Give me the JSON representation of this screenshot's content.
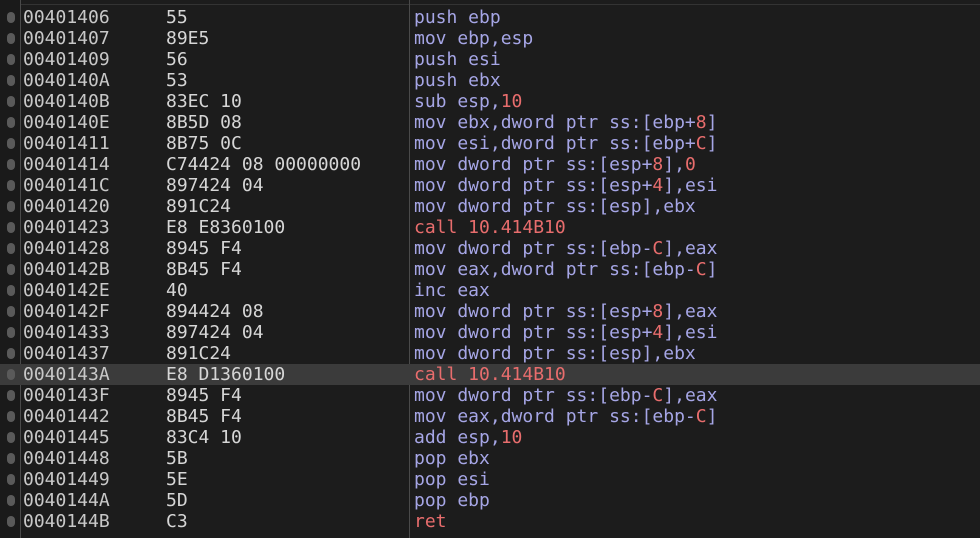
{
  "rows": [
    {
      "addr": "00401406",
      "bytes": "55",
      "instr": [
        [
          "push ebp",
          "p"
        ]
      ]
    },
    {
      "addr": "00401407",
      "bytes": "89E5",
      "instr": [
        [
          "mov ebp,esp",
          "p"
        ]
      ]
    },
    {
      "addr": "00401409",
      "bytes": "56",
      "instr": [
        [
          "push esi",
          "p"
        ]
      ]
    },
    {
      "addr": "0040140A",
      "bytes": "53",
      "instr": [
        [
          "push ebx",
          "p"
        ]
      ]
    },
    {
      "addr": "0040140B",
      "bytes": "83EC 10",
      "instr": [
        [
          "sub esp,",
          "p"
        ],
        [
          "10",
          "n"
        ]
      ]
    },
    {
      "addr": "0040140E",
      "bytes": "8B5D 08",
      "instr": [
        [
          "mov ebx,dword ptr ss:[ebp+",
          "p"
        ],
        [
          "8",
          "n"
        ],
        [
          "]",
          "p"
        ]
      ]
    },
    {
      "addr": "00401411",
      "bytes": "8B75 0C",
      "instr": [
        [
          "mov esi,dword ptr ss:[ebp+",
          "p"
        ],
        [
          "C",
          "n"
        ],
        [
          "]",
          "p"
        ]
      ]
    },
    {
      "addr": "00401414",
      "bytes": "C74424 08 00000000",
      "instr": [
        [
          "mov dword ptr ss:[esp+",
          "p"
        ],
        [
          "8",
          "n"
        ],
        [
          "],",
          "p"
        ],
        [
          "0",
          "n"
        ]
      ]
    },
    {
      "addr": "0040141C",
      "bytes": "897424 04",
      "instr": [
        [
          "mov dword ptr ss:[esp+",
          "p"
        ],
        [
          "4",
          "n"
        ],
        [
          "],esi",
          "p"
        ]
      ]
    },
    {
      "addr": "00401420",
      "bytes": "891C24",
      "instr": [
        [
          "mov dword ptr ss:[esp],ebx",
          "p"
        ]
      ]
    },
    {
      "addr": "00401423",
      "bytes": "E8 E8360100",
      "instr": [
        [
          "call 10.414B10",
          "c"
        ]
      ]
    },
    {
      "addr": "00401428",
      "bytes": "8945 F4",
      "instr": [
        [
          "mov dword ptr ss:[ebp-",
          "p"
        ],
        [
          "C",
          "n"
        ],
        [
          "],eax",
          "p"
        ]
      ]
    },
    {
      "addr": "0040142B",
      "bytes": "8B45 F4",
      "instr": [
        [
          "mov eax,dword ptr ss:[ebp-",
          "p"
        ],
        [
          "C",
          "n"
        ],
        [
          "]",
          "p"
        ]
      ]
    },
    {
      "addr": "0040142E",
      "bytes": "40",
      "instr": [
        [
          "inc eax",
          "p"
        ]
      ]
    },
    {
      "addr": "0040142F",
      "bytes": "894424 08",
      "instr": [
        [
          "mov dword ptr ss:[esp+",
          "p"
        ],
        [
          "8",
          "n"
        ],
        [
          "],eax",
          "p"
        ]
      ]
    },
    {
      "addr": "00401433",
      "bytes": "897424 04",
      "instr": [
        [
          "mov dword ptr ss:[esp+",
          "p"
        ],
        [
          "4",
          "n"
        ],
        [
          "],esi",
          "p"
        ]
      ]
    },
    {
      "addr": "00401437",
      "bytes": "891C24",
      "instr": [
        [
          "mov dword ptr ss:[esp],ebx",
          "p"
        ]
      ]
    },
    {
      "addr": "0040143A",
      "bytes": "E8 D1360100",
      "instr": [
        [
          "call 10.414B10",
          "c"
        ]
      ],
      "selected": true
    },
    {
      "addr": "0040143F",
      "bytes": "8945 F4",
      "instr": [
        [
          "mov dword ptr ss:[ebp-",
          "p"
        ],
        [
          "C",
          "n"
        ],
        [
          "],eax",
          "p"
        ]
      ]
    },
    {
      "addr": "00401442",
      "bytes": "8B45 F4",
      "instr": [
        [
          "mov eax,dword ptr ss:[ebp-",
          "p"
        ],
        [
          "C",
          "n"
        ],
        [
          "]",
          "p"
        ]
      ]
    },
    {
      "addr": "00401445",
      "bytes": "83C4 10",
      "instr": [
        [
          "add esp,",
          "p"
        ],
        [
          "10",
          "n"
        ]
      ]
    },
    {
      "addr": "00401448",
      "bytes": "5B",
      "instr": [
        [
          "pop ebx",
          "p"
        ]
      ]
    },
    {
      "addr": "00401449",
      "bytes": "5E",
      "instr": [
        [
          "pop esi",
          "p"
        ]
      ]
    },
    {
      "addr": "0040144A",
      "bytes": "5D",
      "instr": [
        [
          "pop ebp",
          "p"
        ]
      ]
    },
    {
      "addr": "0040144B",
      "bytes": "C3",
      "instr": [
        [
          "ret",
          "r"
        ]
      ]
    }
  ],
  "colors": {
    "background": "#1c1c1c",
    "selected_row": "#3b3b3b",
    "address": "#c8c8c8",
    "bytes": "#d6d6d6",
    "mnemonic": "#a6a6e6",
    "number": "#e86d6d",
    "call": "#e86d6d"
  }
}
